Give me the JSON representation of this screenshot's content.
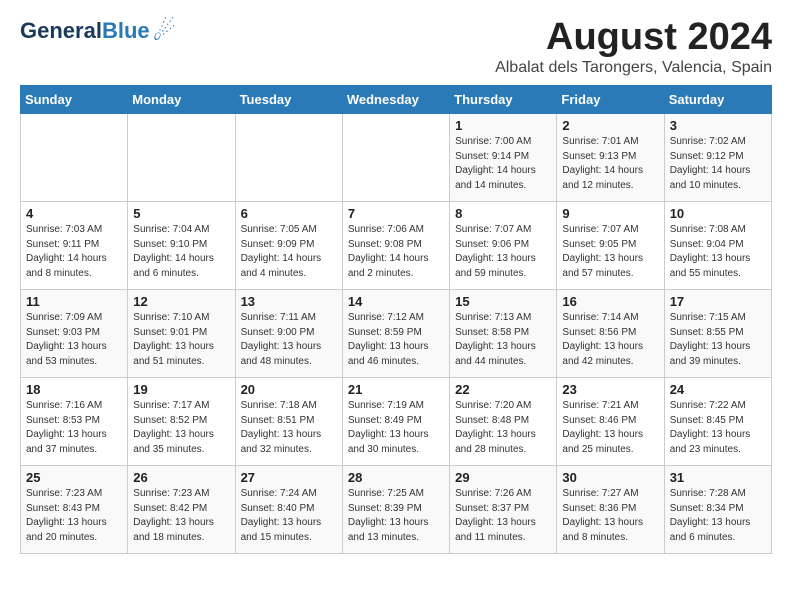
{
  "header": {
    "logo_line1": "General",
    "logo_line2": "Blue",
    "title": "August 2024",
    "subtitle": "Albalat dels Tarongers, Valencia, Spain"
  },
  "days_of_week": [
    "Sunday",
    "Monday",
    "Tuesday",
    "Wednesday",
    "Thursday",
    "Friday",
    "Saturday"
  ],
  "weeks": [
    [
      {
        "day": "",
        "info": ""
      },
      {
        "day": "",
        "info": ""
      },
      {
        "day": "",
        "info": ""
      },
      {
        "day": "",
        "info": ""
      },
      {
        "day": "1",
        "info": "Sunrise: 7:00 AM\nSunset: 9:14 PM\nDaylight: 14 hours\nand 14 minutes."
      },
      {
        "day": "2",
        "info": "Sunrise: 7:01 AM\nSunset: 9:13 PM\nDaylight: 14 hours\nand 12 minutes."
      },
      {
        "day": "3",
        "info": "Sunrise: 7:02 AM\nSunset: 9:12 PM\nDaylight: 14 hours\nand 10 minutes."
      }
    ],
    [
      {
        "day": "4",
        "info": "Sunrise: 7:03 AM\nSunset: 9:11 PM\nDaylight: 14 hours\nand 8 minutes."
      },
      {
        "day": "5",
        "info": "Sunrise: 7:04 AM\nSunset: 9:10 PM\nDaylight: 14 hours\nand 6 minutes."
      },
      {
        "day": "6",
        "info": "Sunrise: 7:05 AM\nSunset: 9:09 PM\nDaylight: 14 hours\nand 4 minutes."
      },
      {
        "day": "7",
        "info": "Sunrise: 7:06 AM\nSunset: 9:08 PM\nDaylight: 14 hours\nand 2 minutes."
      },
      {
        "day": "8",
        "info": "Sunrise: 7:07 AM\nSunset: 9:06 PM\nDaylight: 13 hours\nand 59 minutes."
      },
      {
        "day": "9",
        "info": "Sunrise: 7:07 AM\nSunset: 9:05 PM\nDaylight: 13 hours\nand 57 minutes."
      },
      {
        "day": "10",
        "info": "Sunrise: 7:08 AM\nSunset: 9:04 PM\nDaylight: 13 hours\nand 55 minutes."
      }
    ],
    [
      {
        "day": "11",
        "info": "Sunrise: 7:09 AM\nSunset: 9:03 PM\nDaylight: 13 hours\nand 53 minutes."
      },
      {
        "day": "12",
        "info": "Sunrise: 7:10 AM\nSunset: 9:01 PM\nDaylight: 13 hours\nand 51 minutes."
      },
      {
        "day": "13",
        "info": "Sunrise: 7:11 AM\nSunset: 9:00 PM\nDaylight: 13 hours\nand 48 minutes."
      },
      {
        "day": "14",
        "info": "Sunrise: 7:12 AM\nSunset: 8:59 PM\nDaylight: 13 hours\nand 46 minutes."
      },
      {
        "day": "15",
        "info": "Sunrise: 7:13 AM\nSunset: 8:58 PM\nDaylight: 13 hours\nand 44 minutes."
      },
      {
        "day": "16",
        "info": "Sunrise: 7:14 AM\nSunset: 8:56 PM\nDaylight: 13 hours\nand 42 minutes."
      },
      {
        "day": "17",
        "info": "Sunrise: 7:15 AM\nSunset: 8:55 PM\nDaylight: 13 hours\nand 39 minutes."
      }
    ],
    [
      {
        "day": "18",
        "info": "Sunrise: 7:16 AM\nSunset: 8:53 PM\nDaylight: 13 hours\nand 37 minutes."
      },
      {
        "day": "19",
        "info": "Sunrise: 7:17 AM\nSunset: 8:52 PM\nDaylight: 13 hours\nand 35 minutes."
      },
      {
        "day": "20",
        "info": "Sunrise: 7:18 AM\nSunset: 8:51 PM\nDaylight: 13 hours\nand 32 minutes."
      },
      {
        "day": "21",
        "info": "Sunrise: 7:19 AM\nSunset: 8:49 PM\nDaylight: 13 hours\nand 30 minutes."
      },
      {
        "day": "22",
        "info": "Sunrise: 7:20 AM\nSunset: 8:48 PM\nDaylight: 13 hours\nand 28 minutes."
      },
      {
        "day": "23",
        "info": "Sunrise: 7:21 AM\nSunset: 8:46 PM\nDaylight: 13 hours\nand 25 minutes."
      },
      {
        "day": "24",
        "info": "Sunrise: 7:22 AM\nSunset: 8:45 PM\nDaylight: 13 hours\nand 23 minutes."
      }
    ],
    [
      {
        "day": "25",
        "info": "Sunrise: 7:23 AM\nSunset: 8:43 PM\nDaylight: 13 hours\nand 20 minutes."
      },
      {
        "day": "26",
        "info": "Sunrise: 7:23 AM\nSunset: 8:42 PM\nDaylight: 13 hours\nand 18 minutes."
      },
      {
        "day": "27",
        "info": "Sunrise: 7:24 AM\nSunset: 8:40 PM\nDaylight: 13 hours\nand 15 minutes."
      },
      {
        "day": "28",
        "info": "Sunrise: 7:25 AM\nSunset: 8:39 PM\nDaylight: 13 hours\nand 13 minutes."
      },
      {
        "day": "29",
        "info": "Sunrise: 7:26 AM\nSunset: 8:37 PM\nDaylight: 13 hours\nand 11 minutes."
      },
      {
        "day": "30",
        "info": "Sunrise: 7:27 AM\nSunset: 8:36 PM\nDaylight: 13 hours\nand 8 minutes."
      },
      {
        "day": "31",
        "info": "Sunrise: 7:28 AM\nSunset: 8:34 PM\nDaylight: 13 hours\nand 6 minutes."
      }
    ]
  ]
}
